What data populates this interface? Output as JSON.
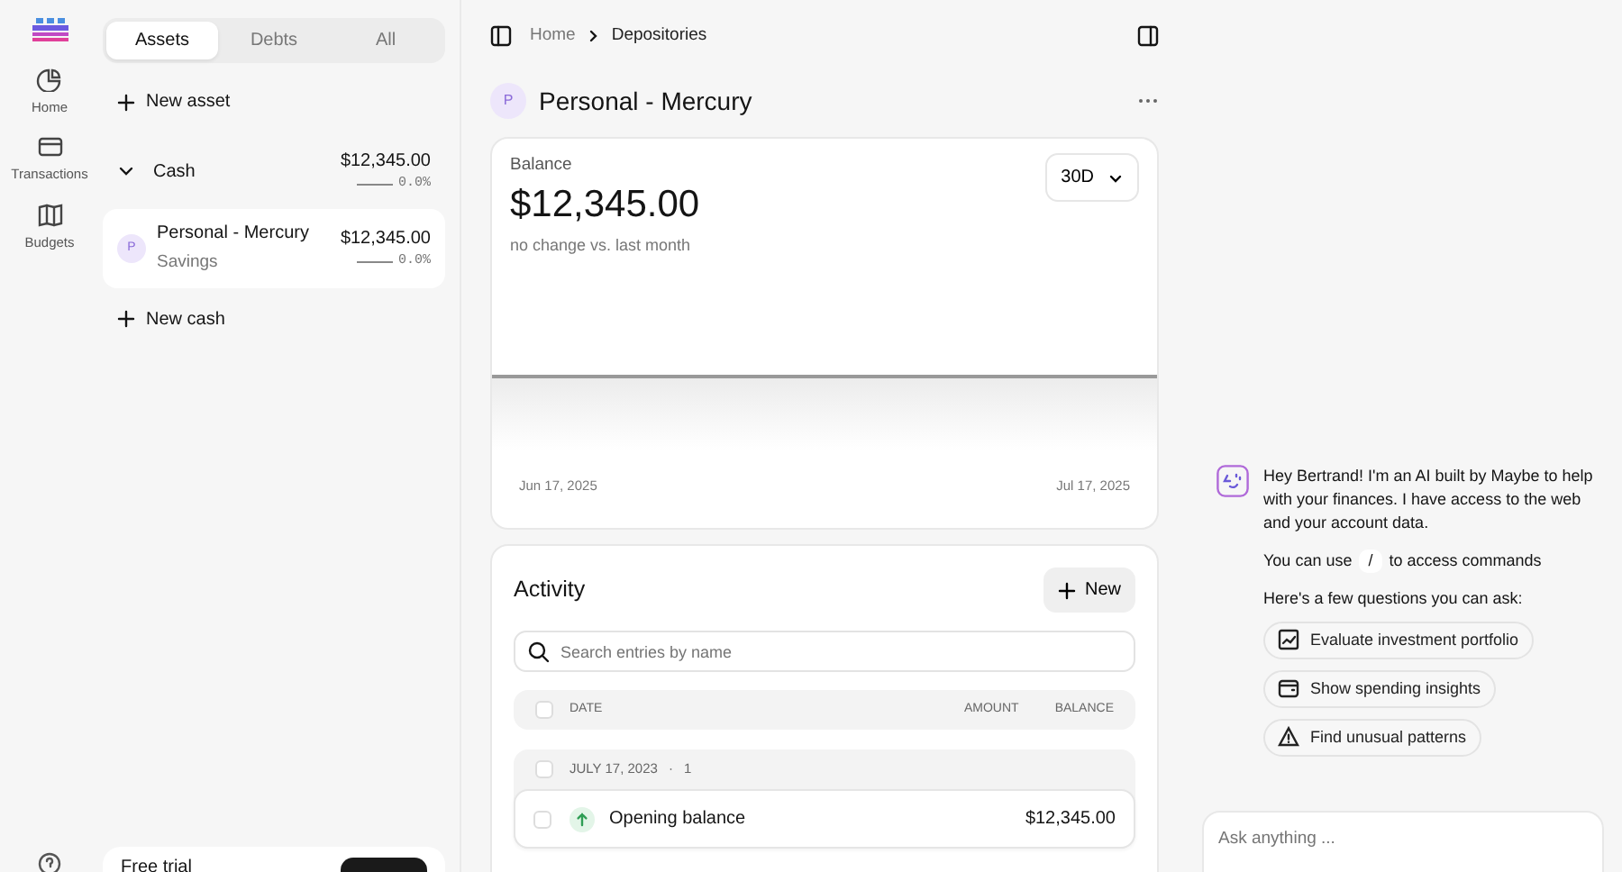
{
  "nav": [
    {
      "label": "Home"
    },
    {
      "label": "Transactions"
    },
    {
      "label": "Budgets"
    }
  ],
  "account_tabs": [
    {
      "label": "Assets",
      "selected": true
    },
    {
      "label": "Debts",
      "selected": false
    },
    {
      "label": "All",
      "selected": false
    }
  ],
  "new_asset": "New asset",
  "groups": [
    {
      "name": "Cash",
      "expanded": true,
      "total": "$12,345.00",
      "change": "0.0%",
      "accounts": [
        {
          "avatar": "P",
          "name": "Personal - Mercury",
          "subtype": "Savings",
          "balance": "$12,345.00",
          "change": "0.0%",
          "selected": true
        }
      ]
    }
  ],
  "new_cash": "New cash",
  "free_trial": {
    "title": "Free trial"
  },
  "breadcrumb": [
    "Home",
    "Depositories"
  ],
  "account": {
    "avatar": "P",
    "name": "Personal - Mercury"
  },
  "balance": {
    "label": "Balance",
    "value": "$12,345.00",
    "comparison": "no change vs. last month",
    "period": "30D",
    "start_date": "Jun 17, 2025",
    "end_date": "Jul 17, 2025"
  },
  "activity": {
    "title": "Activity",
    "new_button": "New",
    "search_placeholder": "Search entries by name",
    "columns": [
      "DATE",
      "AMOUNT",
      "BALANCE"
    ],
    "all_checked": false,
    "groups": [
      {
        "date": "JULY 17, 2023",
        "separator": "·",
        "count": "1",
        "checked": false,
        "entries": [
          {
            "name": "Opening balance",
            "balance": "$12,345.00",
            "checked": false
          }
        ]
      }
    ]
  },
  "chat": {
    "greeting": "Hey Bertrand! I'm an AI built by Maybe to help with your finances. I have access to the web and your account data.",
    "command_prefix": "You can use",
    "command_key": "/",
    "command_suffix": "to access commands",
    "prompt": "Here's a few questions you can ask:",
    "suggestions": [
      "Evaluate investment portfolio",
      "Show spending insights",
      "Find unusual patterns"
    ],
    "input_placeholder": "Ask anything ..."
  }
}
